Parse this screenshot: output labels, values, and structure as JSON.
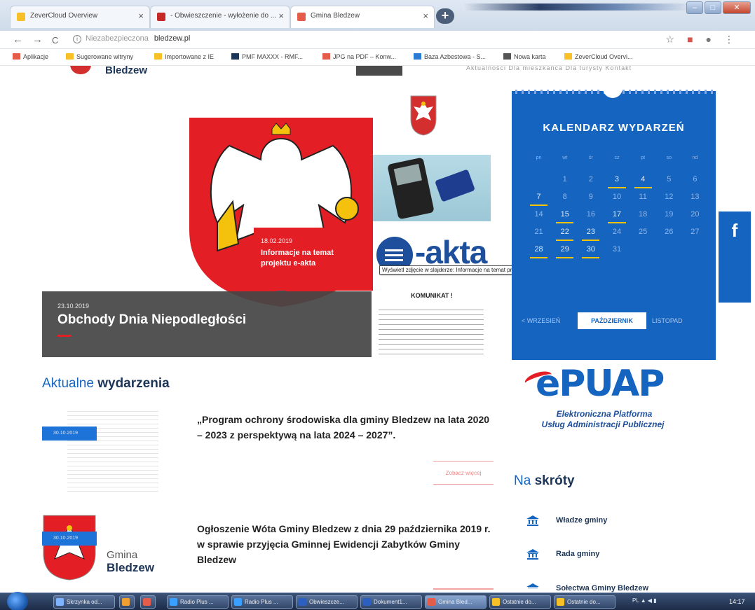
{
  "browser": {
    "tabs": [
      {
        "label": "ZeverCloud Overview",
        "fav_color": "#f6c026"
      },
      {
        "label": "- Obwieszczenie - wyłożenie do ...",
        "fav_color": "#c62828"
      },
      {
        "label": "Gmina Bledzew",
        "fav_color": "#e35d4a"
      }
    ],
    "new_tab": "+",
    "window_buttons": {
      "minimize": "–",
      "maximize": "□",
      "close": "✕"
    },
    "nav": {
      "back": "←",
      "forward": "→",
      "reload": "C"
    },
    "address": {
      "security": "Niezabezpieczona",
      "host": "bledzew.pl"
    },
    "addr_icons": {
      "star": "☆",
      "extension": "■",
      "account": "●",
      "menu": "⋮"
    },
    "bookmarks": [
      {
        "label": "Aplikacje",
        "color": "#e35d4a"
      },
      {
        "label": "Sugerowane witryny",
        "color": "#f6c026"
      },
      {
        "label": "Importowane z IE",
        "color": "#f6c026"
      },
      {
        "label": "PMF MAXXX - RMF...",
        "color": "#1d3557"
      },
      {
        "label": "JPG na PDF – Konw...",
        "color": "#e35d4a"
      },
      {
        "label": "Baza Azbestowa - S...",
        "color": "#2a7bd1"
      },
      {
        "label": "Nowa karta",
        "color": "#555555"
      },
      {
        "label": "ZeverCloud Overvi...",
        "color": "#f6c026"
      }
    ]
  },
  "site": {
    "logo_text": "Bledzew",
    "top_menu": "Aktualności   Dla mieszkańca   Dla turysty   Kontakt",
    "slider": {
      "red_card": {
        "date": "18.02.2019",
        "title": "Informacje na temat projektu e-akta"
      },
      "tooltip": "Wyświetl zdjęcie w slajderze: Informacje na temat projektu e-akta",
      "eakta_word": "-akta",
      "komunikat": "KOMUNIKAT !",
      "main": {
        "date": "23.10.2019",
        "title": "Obchody Dnia Niepodległości"
      }
    },
    "calendar": {
      "title": "KALENDARZ WYDARZEŃ",
      "dows": [
        "pn",
        "wt",
        "śr",
        "cz",
        "pt",
        "so",
        "nd"
      ],
      "weeks": [
        [
          "",
          "1",
          "2",
          "3",
          "4",
          "5",
          "6"
        ],
        [
          "7",
          "8",
          "9",
          "10",
          "11",
          "12",
          "13"
        ],
        [
          "14",
          "15",
          "16",
          "17",
          "18",
          "19",
          "20"
        ],
        [
          "21",
          "22",
          "23",
          "24",
          "25",
          "26",
          "27"
        ],
        [
          "28",
          "29",
          "30",
          "31",
          "",
          "",
          ""
        ]
      ],
      "event_days": [
        "3",
        "4",
        "7",
        "15",
        "17",
        "22",
        "23",
        "28",
        "29",
        "30"
      ],
      "prev": "< WRZESIEŃ",
      "current": "PAŹDZIERNIK",
      "next": "LISTOPAD",
      "accent": "#1565c0",
      "marker": "#f9c400"
    },
    "facebook": "f",
    "events": {
      "heading_light": "Aktualne ",
      "heading_bold": "wydarzenia",
      "items": [
        {
          "date": "30.10.2019",
          "title": "„Program ochrony środowiska dla gminy Bledzew na lata 2020 – 2023 z perspektywą na lata 2024 – 2027”."
        },
        {
          "date": "30.10.2019",
          "title": "Ogłoszenie Wóta Gminy Bledzew z dnia 29 października 2019 r. w sprawie przyjęcia Gminnej Ewidencji Zabytków Gminy Bledzew"
        }
      ],
      "more": "Zobacz więcej",
      "gmina_line1": "Gmina",
      "gmina_line2": "Bledzew"
    },
    "epuap": {
      "word": "ePUAP",
      "line1": "Elektroniczna Platforma",
      "line2": "Usług Administracji Publicznej"
    },
    "shortcuts": {
      "heading_light": "Na ",
      "heading_bold": "skróty",
      "items": [
        "Władze gminy",
        "Rada gminy",
        "Sołectwa Gminy Bledzew"
      ]
    }
  },
  "taskbar": {
    "items": [
      {
        "label": "Skrzynka od...",
        "color": "#7fb3ff"
      },
      {
        "label": "",
        "color": "#f0a030"
      },
      {
        "label": "",
        "color": "#e35d4a"
      },
      {
        "label": "Radio Plus ...",
        "color": "#3aa0ff"
      },
      {
        "label": "Radio Plus ...",
        "color": "#3aa0ff"
      },
      {
        "label": "Obwieszcze...",
        "color": "#2b5fc0"
      },
      {
        "label": "Dokument1...",
        "color": "#2b5fc0"
      },
      {
        "label": "Gmina Bled...",
        "color": "#e35d4a"
      },
      {
        "label": "Ostatnie do...",
        "color": "#f6c026"
      },
      {
        "label": "Ostatnie do...",
        "color": "#f6c026"
      }
    ],
    "tray": "PL  ▲  ◀  ▮",
    "clock": "14:17"
  }
}
